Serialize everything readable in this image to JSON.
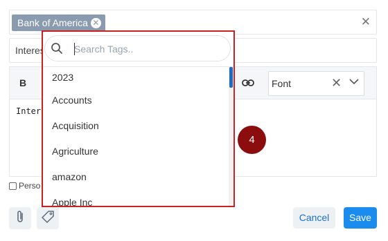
{
  "tag_field": {
    "chip_label": "Bank of America",
    "chip_remove_glyph": "✕",
    "clear_glyph": "✕"
  },
  "subject": {
    "value": "Interes"
  },
  "toolbar": {
    "bold_label": "B",
    "link_icon": "link-icon",
    "font_label": "Font",
    "font_clear_glyph": "✕",
    "font_chevron_glyph": "⌄"
  },
  "editor": {
    "text": "Intere"
  },
  "personal": {
    "label": "Perso"
  },
  "dropdown": {
    "search_placeholder": "Search Tags..",
    "items": [
      "2023",
      "Accounts",
      "Acquisition",
      "Agriculture",
      "amazon",
      "Apple Inc"
    ]
  },
  "footer": {
    "cancel_label": "Cancel",
    "save_label": "Save"
  },
  "step_badge": {
    "label": "4"
  },
  "colors": {
    "chip_bg": "#8a9bb0",
    "highlight_border": "#cc1f1f",
    "badge_bg": "#8b0d0d",
    "save_bg": "#1a8ced",
    "cancel_text": "#1c6fd1",
    "scroll_thumb": "#1f6ac2"
  }
}
